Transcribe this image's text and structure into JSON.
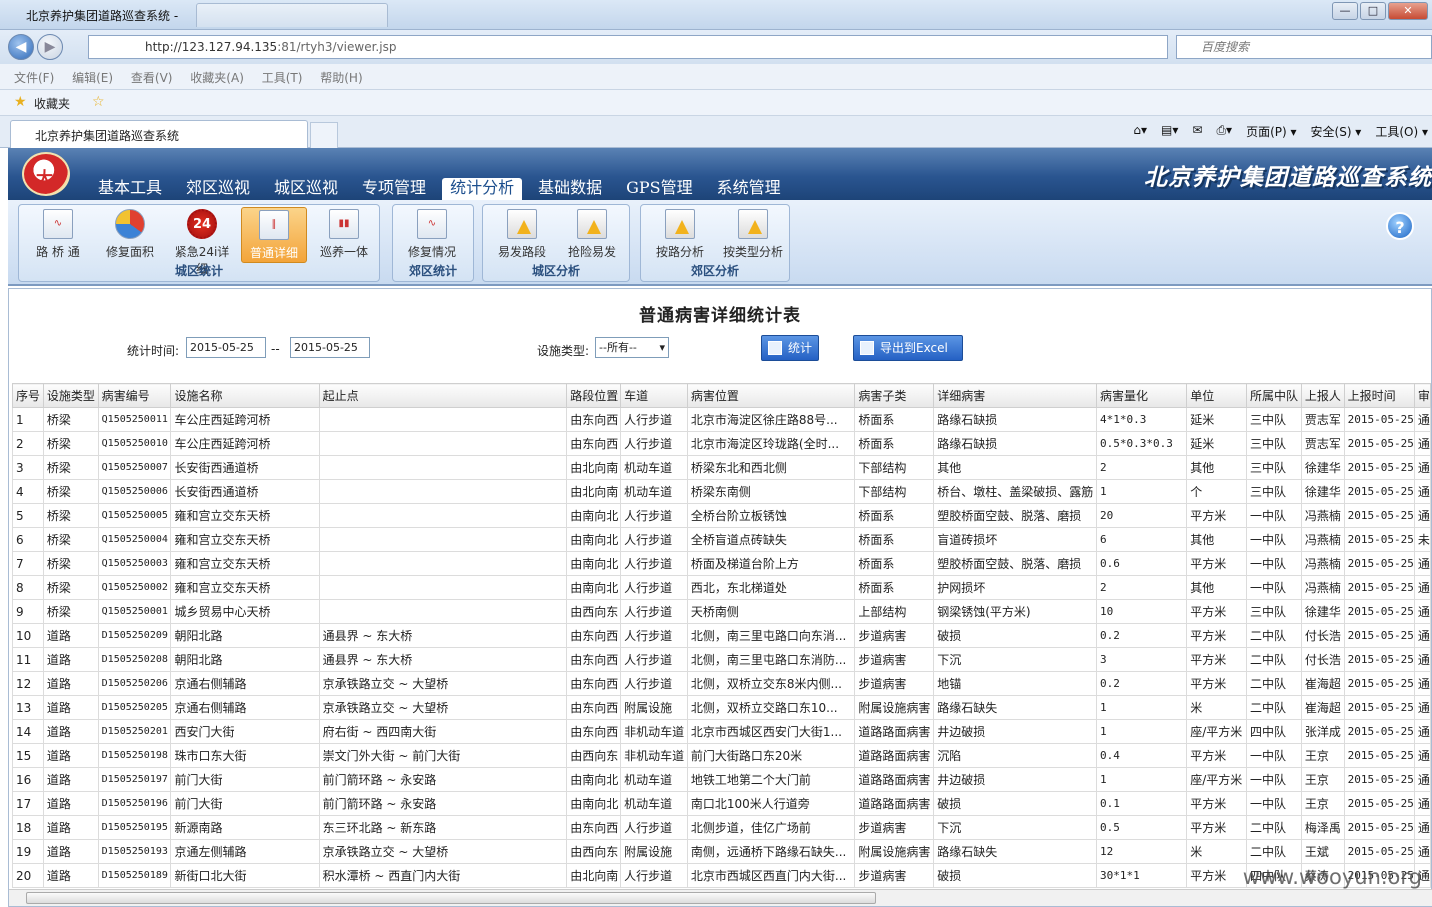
{
  "browser": {
    "title": "北京养护集团道路巡查系统 -",
    "url_host": "http://123.127.94.135",
    "url_path": ":81/rtyh3/viewer.jsp",
    "search_placeholder": "百度搜索",
    "menu": [
      "文件(F)",
      "编辑(E)",
      "查看(V)",
      "收藏夹(A)",
      "工具(T)",
      "帮助(H)"
    ],
    "favorites_label": "收藏夹",
    "tab_label": "北京养护集团道路巡查系统",
    "cmd": [
      "页面(P) ▾",
      "安全(S) ▾",
      "工具(O) ▾"
    ]
  },
  "app": {
    "logo_glyph": "大",
    "system_name": "北京养护集团道路巡查系统",
    "nav": [
      "基本工具",
      "郊区巡视",
      "城区巡视",
      "专项管理",
      "统计分析",
      "基础数据",
      "GPS管理",
      "系统管理"
    ],
    "active_nav": "统计分析",
    "groups": [
      {
        "label": "城区统计",
        "buttons": [
          "路 桥 通",
          "修复面积",
          "紧急24i详细",
          "普通详细",
          "巡养一体"
        ]
      },
      {
        "label": "郊区统计",
        "buttons": [
          "修复情况"
        ]
      },
      {
        "label": "城区分析",
        "buttons": [
          "易发路段",
          "抢险易发"
        ]
      },
      {
        "label": "郊区分析",
        "buttons": [
          "按路分析",
          "按类型分析"
        ]
      }
    ],
    "badge_value": "24"
  },
  "report": {
    "title": "普通病害详细统计表",
    "time_label": "统计时间:",
    "date_from": "2015-05-25",
    "date_sep": "--",
    "date_to": "2015-05-25",
    "type_label": "设施类型:",
    "type_value": "--所有--",
    "stat_button": "统计",
    "export_button": "导出到Excel"
  },
  "table": {
    "headers": [
      "序号",
      "设施类型",
      "病害编号",
      "设施名称",
      "起止点",
      "路段位置",
      "车道",
      "病害位置",
      "病害子类",
      "详细病害",
      "病害量化",
      "单位",
      "所属中队",
      "上报人",
      "上报时间",
      "审"
    ],
    "rows": [
      [
        "1",
        "桥梁",
        "Q1505250011",
        "车公庄西延跨河桥",
        "",
        "由东向西",
        "人行步道",
        "北京市海淀区徐庄路88号...",
        "桥面系",
        "路缘石缺损",
        "4*1*0.3",
        "延米",
        "三中队",
        "贾志军",
        "2015-05-25",
        "通"
      ],
      [
        "2",
        "桥梁",
        "Q1505250010",
        "车公庄西延跨河桥",
        "",
        "由东向西",
        "人行步道",
        "北京市海淀区玲珑路(全时...",
        "桥面系",
        "路缘石缺损",
        "0.5*0.3*0.3",
        "延米",
        "三中队",
        "贾志军",
        "2015-05-25",
        "通"
      ],
      [
        "3",
        "桥梁",
        "Q1505250007",
        "长安街西通道桥",
        "",
        "由北向南",
        "机动车道",
        "桥梁东北和西北侧",
        "下部结构",
        "其他",
        "2",
        "其他",
        "三中队",
        "徐建华",
        "2015-05-25",
        "通"
      ],
      [
        "4",
        "桥梁",
        "Q1505250006",
        "长安街西通道桥",
        "",
        "由北向南",
        "机动车道",
        "桥梁东南侧",
        "下部结构",
        "桥台、墩柱、盖梁破损、露筋",
        "1",
        "个",
        "三中队",
        "徐建华",
        "2015-05-25",
        "通"
      ],
      [
        "5",
        "桥梁",
        "Q1505250005",
        "雍和宫立交东天桥",
        "",
        "由南向北",
        "人行步道",
        "全桥台阶立板锈蚀",
        "桥面系",
        "塑胶桥面空鼓、脱落、磨损",
        "20",
        "平方米",
        "一中队",
        "冯燕楠",
        "2015-05-25",
        "通"
      ],
      [
        "6",
        "桥梁",
        "Q1505250004",
        "雍和宫立交东天桥",
        "",
        "由南向北",
        "人行步道",
        "全桥盲道点砖缺失",
        "桥面系",
        "盲道砖损坏",
        "6",
        "其他",
        "一中队",
        "冯燕楠",
        "2015-05-25",
        "未"
      ],
      [
        "7",
        "桥梁",
        "Q1505250003",
        "雍和宫立交东天桥",
        "",
        "由南向北",
        "人行步道",
        "桥面及梯道台阶上方",
        "桥面系",
        "塑胶桥面空鼓、脱落、磨损",
        "0.6",
        "平方米",
        "一中队",
        "冯燕楠",
        "2015-05-25",
        "通"
      ],
      [
        "8",
        "桥梁",
        "Q1505250002",
        "雍和宫立交东天桥",
        "",
        "由南向北",
        "人行步道",
        "西北，东北梯道处",
        "桥面系",
        "护网损坏",
        "2",
        "其他",
        "一中队",
        "冯燕楠",
        "2015-05-25",
        "通"
      ],
      [
        "9",
        "桥梁",
        "Q1505250001",
        "城乡贸易中心天桥",
        "",
        "由西向东",
        "人行步道",
        "天桥南侧",
        "上部结构",
        "钢梁锈蚀(平方米)",
        "10",
        "平方米",
        "三中队",
        "徐建华",
        "2015-05-25",
        "通"
      ],
      [
        "10",
        "道路",
        "D1505250209",
        "朝阳北路",
        "通县界 ~ 东大桥",
        "由东向西",
        "人行步道",
        "北侧，南三里屯路口向东消...",
        "步道病害",
        "破损",
        "0.2",
        "平方米",
        "二中队",
        "付长浩",
        "2015-05-25",
        "通"
      ],
      [
        "11",
        "道路",
        "D1505250208",
        "朝阳北路",
        "通县界 ~ 东大桥",
        "由东向西",
        "人行步道",
        "北侧，南三里屯路口东消防...",
        "步道病害",
        "下沉",
        "3",
        "平方米",
        "二中队",
        "付长浩",
        "2015-05-25",
        "通"
      ],
      [
        "12",
        "道路",
        "D1505250206",
        "京通右侧辅路",
        "京承铁路立交 ~ 大望桥",
        "由东向西",
        "人行步道",
        "北侧，双桥立交东8米内侧...",
        "步道病害",
        "地锚",
        "0.2",
        "平方米",
        "二中队",
        "崔海超",
        "2015-05-25",
        "通"
      ],
      [
        "13",
        "道路",
        "D1505250205",
        "京通右侧辅路",
        "京承铁路立交 ~ 大望桥",
        "由东向西",
        "附属设施",
        "北侧，双桥立交路口东10...",
        "附属设施病害",
        "路缘石缺失",
        "1",
        "米",
        "二中队",
        "崔海超",
        "2015-05-25",
        "通"
      ],
      [
        "14",
        "道路",
        "D1505250201",
        "西安门大街",
        "府右街 ~ 西四南大街",
        "由东向西",
        "非机动车道",
        "北京市西城区西安门大街1...",
        "道路路面病害",
        "井边破损",
        "1",
        "座/平方米",
        "四中队",
        "张洋成",
        "2015-05-25",
        "通"
      ],
      [
        "15",
        "道路",
        "D1505250198",
        "珠市口东大街",
        "崇文门外大街 ~ 前门大街",
        "由西向东",
        "非机动车道",
        "前门大街路口东20米",
        "道路路面病害",
        "沉陷",
        "0.4",
        "平方米",
        "一中队",
        "王京",
        "2015-05-25",
        "通"
      ],
      [
        "16",
        "道路",
        "D1505250197",
        "前门大街",
        "前门箭环路 ~ 永安路",
        "由南向北",
        "机动车道",
        "地铁工地第二个大门前",
        "道路路面病害",
        "井边破损",
        "1",
        "座/平方米",
        "一中队",
        "王京",
        "2015-05-25",
        "通"
      ],
      [
        "17",
        "道路",
        "D1505250196",
        "前门大街",
        "前门箭环路 ~ 永安路",
        "由南向北",
        "机动车道",
        "南口北100米人行道旁",
        "道路路面病害",
        "破损",
        "0.1",
        "平方米",
        "一中队",
        "王京",
        "2015-05-25",
        "通"
      ],
      [
        "18",
        "道路",
        "D1505250195",
        "新源南路",
        "东三环北路 ~ 新东路",
        "由东向西",
        "人行步道",
        "北侧步道，佳亿广场前",
        "步道病害",
        "下沉",
        "0.5",
        "平方米",
        "二中队",
        "梅泽禹",
        "2015-05-25",
        "通"
      ],
      [
        "19",
        "道路",
        "D1505250193",
        "京通左侧辅路",
        "京承铁路立交 ~ 大望桥",
        "由西向东",
        "附属设施",
        "南侧，远通桥下路缘石缺失...",
        "附属设施病害",
        "路缘石缺失",
        "12",
        "米",
        "二中队",
        "王斌",
        "2015-05-25",
        "通"
      ],
      [
        "20",
        "道路",
        "D1505250189",
        "新街口北大街",
        "积水潭桥 ~ 西直门内大街",
        "由北向南",
        "人行步道",
        "北京市西城区西直门内大街...",
        "步道病害",
        "破损",
        "30*1*1",
        "平方米",
        "四中队",
        "蔡涛",
        "2015-05-25",
        "通"
      ]
    ]
  },
  "watermark": "www.wooyun.org"
}
